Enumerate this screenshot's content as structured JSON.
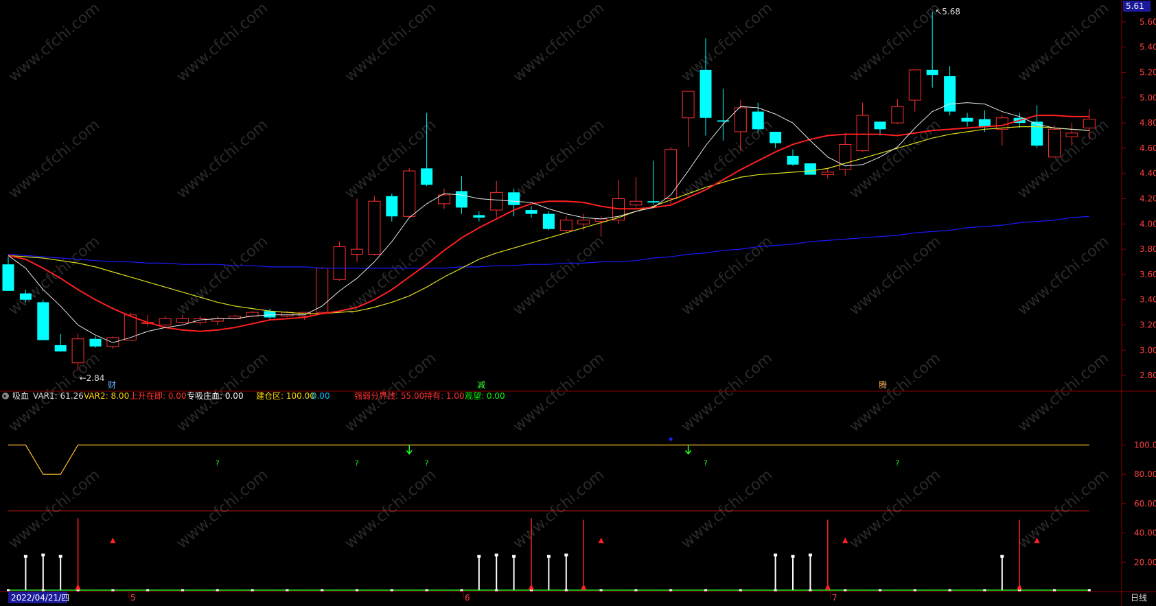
{
  "price_axis": {
    "current": "5.61",
    "ticks": [
      "5.60",
      "5.40",
      "5.20",
      "5.00",
      "4.80",
      "4.60",
      "4.40",
      "4.20",
      "4.00",
      "3.80",
      "3.60",
      "3.40",
      "3.20",
      "3.00",
      "2.80"
    ]
  },
  "indicator_axis": {
    "ticks": [
      "100.00",
      "80.00",
      "60.00",
      "40.00",
      "20.00"
    ]
  },
  "annotations": {
    "high": "5.68",
    "low": "2.84"
  },
  "event_markers": [
    {
      "text": "财"
    },
    {
      "text": "减"
    },
    {
      "text": "腾"
    }
  ],
  "indicator_header": {
    "name": "吸血",
    "items": [
      {
        "text": "VAR1: 61.26",
        "color": "#dddddd"
      },
      {
        "text": "VAR2: 8.00",
        "color": "#ffd700"
      },
      {
        "text": "上升在即: 0.00",
        "color": "#ff3030"
      },
      {
        "text": "专吸庄血: 0.00",
        "color": "#ffffff"
      },
      {
        "text": "建仓区: 100.00",
        "color": "#ffd700"
      },
      {
        "text": ": 0.00",
        "color": "#00bfff"
      },
      {
        "text": "强弱分界线: 55.00",
        "color": "#ff3030"
      },
      {
        "text": "持有: 1.00",
        "color": "#ff3030"
      },
      {
        "text": "观望: 0.00",
        "color": "#00ff00"
      }
    ]
  },
  "date_axis": {
    "date": "2022/04/21/四",
    "months": [
      "5",
      "6",
      "7"
    ],
    "period": "日线"
  },
  "colors": {
    "up": "#ff3030",
    "down": "#00ffff",
    "ma5": "#e8e8e8",
    "ma10": "#ff2020",
    "ma20": "#e0e020",
    "ma60": "#1a1aff",
    "grid": "#8b0000"
  },
  "chart_data": {
    "type": "candlestick",
    "ylim": [
      2.73,
      5.73
    ],
    "candles": [
      {
        "o": 3.68,
        "h": 3.74,
        "l": 3.47,
        "c": 3.47
      },
      {
        "o": 3.45,
        "h": 3.48,
        "l": 3.38,
        "c": 3.4
      },
      {
        "o": 3.38,
        "h": 3.4,
        "l": 3.08,
        "c": 3.08
      },
      {
        "o": 3.04,
        "h": 3.13,
        "l": 2.99,
        "c": 2.99
      },
      {
        "o": 2.9,
        "h": 3.13,
        "l": 2.84,
        "c": 3.09
      },
      {
        "o": 3.09,
        "h": 3.11,
        "l": 3.02,
        "c": 3.03
      },
      {
        "o": 3.03,
        "h": 3.11,
        "l": 3.01,
        "c": 3.1
      },
      {
        "o": 3.08,
        "h": 3.3,
        "l": 3.08,
        "c": 3.28
      },
      {
        "o": 3.22,
        "h": 3.28,
        "l": 3.19,
        "c": 3.22
      },
      {
        "o": 3.2,
        "h": 3.27,
        "l": 3.19,
        "c": 3.25
      },
      {
        "o": 3.22,
        "h": 3.28,
        "l": 3.21,
        "c": 3.25
      },
      {
        "o": 3.22,
        "h": 3.27,
        "l": 3.2,
        "c": 3.25
      },
      {
        "o": 3.23,
        "h": 3.27,
        "l": 3.2,
        "c": 3.25
      },
      {
        "o": 3.25,
        "h": 3.28,
        "l": 3.24,
        "c": 3.27
      },
      {
        "o": 3.27,
        "h": 3.31,
        "l": 3.26,
        "c": 3.3
      },
      {
        "o": 3.31,
        "h": 3.33,
        "l": 3.25,
        "c": 3.26
      },
      {
        "o": 3.27,
        "h": 3.31,
        "l": 3.26,
        "c": 3.3
      },
      {
        "o": 3.27,
        "h": 3.3,
        "l": 3.24,
        "c": 3.3
      },
      {
        "o": 3.3,
        "h": 3.66,
        "l": 3.29,
        "c": 3.65
      },
      {
        "o": 3.56,
        "h": 3.86,
        "l": 3.55,
        "c": 3.82
      },
      {
        "o": 3.76,
        "h": 4.2,
        "l": 3.7,
        "c": 3.8
      },
      {
        "o": 3.76,
        "h": 4.22,
        "l": 3.75,
        "c": 4.18
      },
      {
        "o": 4.22,
        "h": 4.24,
        "l": 4.02,
        "c": 4.06
      },
      {
        "o": 4.06,
        "h": 4.44,
        "l": 4.05,
        "c": 4.42
      },
      {
        "o": 4.44,
        "h": 4.88,
        "l": 4.3,
        "c": 4.31
      },
      {
        "o": 4.16,
        "h": 4.28,
        "l": 4.12,
        "c": 4.23
      },
      {
        "o": 4.26,
        "h": 4.38,
        "l": 4.08,
        "c": 4.13
      },
      {
        "o": 4.07,
        "h": 4.1,
        "l": 4.02,
        "c": 4.05
      },
      {
        "o": 4.11,
        "h": 4.34,
        "l": 4.05,
        "c": 4.25
      },
      {
        "o": 4.25,
        "h": 4.28,
        "l": 4.06,
        "c": 4.15
      },
      {
        "o": 4.11,
        "h": 4.14,
        "l": 4.05,
        "c": 4.08
      },
      {
        "o": 4.08,
        "h": 4.1,
        "l": 3.95,
        "c": 3.96
      },
      {
        "o": 3.95,
        "h": 4.06,
        "l": 3.93,
        "c": 4.03
      },
      {
        "o": 4.0,
        "h": 4.08,
        "l": 3.95,
        "c": 4.03
      },
      {
        "o": 4.02,
        "h": 4.06,
        "l": 3.9,
        "c": 4.04
      },
      {
        "o": 4.03,
        "h": 4.35,
        "l": 4.0,
        "c": 4.2
      },
      {
        "o": 4.15,
        "h": 4.37,
        "l": 4.13,
        "c": 4.18
      },
      {
        "o": 4.18,
        "h": 4.5,
        "l": 4.15,
        "c": 4.17
      },
      {
        "o": 4.2,
        "h": 4.61,
        "l": 4.16,
        "c": 4.59
      },
      {
        "o": 4.84,
        "h": 5.02,
        "l": 4.61,
        "c": 5.05
      },
      {
        "o": 5.22,
        "h": 5.47,
        "l": 4.7,
        "c": 4.84
      },
      {
        "o": 4.82,
        "h": 5.07,
        "l": 4.66,
        "c": 4.81
      },
      {
        "o": 4.73,
        "h": 4.98,
        "l": 4.58,
        "c": 4.92
      },
      {
        "o": 4.89,
        "h": 4.96,
        "l": 4.72,
        "c": 4.75
      },
      {
        "o": 4.73,
        "h": 4.73,
        "l": 4.6,
        "c": 4.64
      },
      {
        "o": 4.54,
        "h": 4.59,
        "l": 4.46,
        "c": 4.47
      },
      {
        "o": 4.48,
        "h": 4.48,
        "l": 4.39,
        "c": 4.39
      },
      {
        "o": 4.39,
        "h": 4.44,
        "l": 4.36,
        "c": 4.41
      },
      {
        "o": 4.43,
        "h": 4.72,
        "l": 4.38,
        "c": 4.63
      },
      {
        "o": 4.58,
        "h": 4.96,
        "l": 4.57,
        "c": 4.86
      },
      {
        "o": 4.81,
        "h": 4.81,
        "l": 4.7,
        "c": 4.75
      },
      {
        "o": 4.8,
        "h": 4.99,
        "l": 4.79,
        "c": 4.93
      },
      {
        "o": 4.98,
        "h": 5.22,
        "l": 4.89,
        "c": 5.22
      },
      {
        "o": 5.22,
        "h": 5.68,
        "l": 5.08,
        "c": 5.18
      },
      {
        "o": 5.17,
        "h": 5.25,
        "l": 4.86,
        "c": 4.89
      },
      {
        "o": 4.84,
        "h": 4.88,
        "l": 4.77,
        "c": 4.81
      },
      {
        "o": 4.83,
        "h": 4.9,
        "l": 4.73,
        "c": 4.77
      },
      {
        "o": 4.75,
        "h": 4.86,
        "l": 4.62,
        "c": 4.84
      },
      {
        "o": 4.84,
        "h": 4.88,
        "l": 4.76,
        "c": 4.8
      },
      {
        "o": 4.81,
        "h": 4.94,
        "l": 4.6,
        "c": 4.62
      },
      {
        "o": 4.53,
        "h": 4.78,
        "l": 4.53,
        "c": 4.75
      },
      {
        "o": 4.69,
        "h": 4.8,
        "l": 4.62,
        "c": 4.72
      },
      {
        "o": 4.76,
        "h": 4.91,
        "l": 4.67,
        "c": 4.83
      }
    ],
    "ma5": [
      3.75,
      3.65,
      3.48,
      3.35,
      3.2,
      3.12,
      3.06,
      3.1,
      3.15,
      3.18,
      3.2,
      3.24,
      3.25,
      3.25,
      3.27,
      3.28,
      3.28,
      3.28,
      3.35,
      3.47,
      3.57,
      3.7,
      3.86,
      4.05,
      4.16,
      4.24,
      4.23,
      4.2,
      4.19,
      4.18,
      4.17,
      4.12,
      4.08,
      4.05,
      4.04,
      4.06,
      4.1,
      4.13,
      4.23,
      4.42,
      4.62,
      4.79,
      4.93,
      4.92,
      4.87,
      4.8,
      4.66,
      4.53,
      4.46,
      4.47,
      4.53,
      4.61,
      4.76,
      4.89,
      4.95,
      4.96,
      4.95,
      4.89,
      4.85,
      4.79,
      4.76,
      4.75,
      4.74
    ],
    "ma10": [
      3.75,
      3.72,
      3.65,
      3.57,
      3.48,
      3.4,
      3.33,
      3.27,
      3.22,
      3.18,
      3.16,
      3.15,
      3.16,
      3.18,
      3.21,
      3.24,
      3.25,
      3.26,
      3.29,
      3.31,
      3.34,
      3.4,
      3.48,
      3.58,
      3.68,
      3.79,
      3.89,
      3.97,
      4.04,
      4.11,
      4.16,
      4.18,
      4.18,
      4.17,
      4.14,
      4.12,
      4.12,
      4.13,
      4.15,
      4.21,
      4.27,
      4.35,
      4.43,
      4.5,
      4.57,
      4.63,
      4.67,
      4.7,
      4.71,
      4.71,
      4.71,
      4.7,
      4.72,
      4.74,
      4.75,
      4.76,
      4.77,
      4.78,
      4.82,
      4.86,
      4.86,
      4.85,
      4.85
    ],
    "ma20": [
      3.75,
      3.74,
      3.73,
      3.71,
      3.69,
      3.66,
      3.62,
      3.58,
      3.54,
      3.5,
      3.46,
      3.42,
      3.38,
      3.35,
      3.33,
      3.31,
      3.3,
      3.29,
      3.29,
      3.3,
      3.31,
      3.34,
      3.38,
      3.43,
      3.5,
      3.58,
      3.65,
      3.72,
      3.77,
      3.81,
      3.85,
      3.89,
      3.93,
      3.97,
      4.01,
      4.05,
      4.1,
      4.14,
      4.19,
      4.24,
      4.29,
      4.33,
      4.37,
      4.39,
      4.4,
      4.41,
      4.42,
      4.44,
      4.48,
      4.52,
      4.56,
      4.6,
      4.64,
      4.68,
      4.71,
      4.73,
      4.75,
      4.76,
      4.77,
      4.77,
      4.76,
      4.75,
      4.74
    ],
    "ma60": [
      3.76,
      3.75,
      3.74,
      3.73,
      3.72,
      3.71,
      3.7,
      3.7,
      3.69,
      3.69,
      3.68,
      3.68,
      3.68,
      3.67,
      3.67,
      3.66,
      3.66,
      3.66,
      3.65,
      3.65,
      3.65,
      3.65,
      3.65,
      3.65,
      3.65,
      3.65,
      3.66,
      3.66,
      3.67,
      3.67,
      3.68,
      3.68,
      3.69,
      3.69,
      3.7,
      3.7,
      3.71,
      3.73,
      3.74,
      3.76,
      3.77,
      3.79,
      3.8,
      3.82,
      3.83,
      3.84,
      3.86,
      3.87,
      3.88,
      3.89,
      3.9,
      3.91,
      3.93,
      3.94,
      3.95,
      3.97,
      3.98,
      3.99,
      4.01,
      4.02,
      4.03,
      4.05,
      4.06
    ],
    "indicator": {
      "ylim": [
        0,
        125
      ],
      "yellow_line": [
        100,
        100,
        80,
        80,
        100,
        100,
        100,
        100,
        100,
        100,
        100,
        100,
        100,
        100,
        100,
        100,
        100,
        100,
        100,
        100,
        100,
        100,
        100,
        100,
        100,
        100,
        100,
        100,
        100,
        100,
        100,
        100,
        100,
        100,
        100,
        100,
        100,
        100,
        100,
        100,
        100,
        100,
        100,
        100,
        100,
        100,
        100,
        100,
        100,
        100,
        100,
        100,
        100,
        100,
        100,
        100,
        100,
        100,
        100,
        100,
        100,
        100,
        100
      ],
      "threshold": 55,
      "white_bars": [
        {
          "i": 1,
          "v": 24
        },
        {
          "i": 2,
          "v": 25
        },
        {
          "i": 3,
          "v": 24
        },
        {
          "i": 27,
          "v": 24
        },
        {
          "i": 28,
          "v": 25
        },
        {
          "i": 29,
          "v": 24
        },
        {
          "i": 31,
          "v": 24
        },
        {
          "i": 32,
          "v": 25
        },
        {
          "i": 44,
          "v": 25
        },
        {
          "i": 45,
          "v": 24
        },
        {
          "i": 46,
          "v": 25
        },
        {
          "i": 57,
          "v": 24
        }
      ],
      "red_bars": [
        {
          "i": 4,
          "v": 50
        },
        {
          "i": 30,
          "v": 50
        },
        {
          "i": 33,
          "v": 49
        },
        {
          "i": 47,
          "v": 49
        },
        {
          "i": 58,
          "v": 49
        }
      ],
      "red_triangles": [
        6,
        34,
        48,
        59
      ],
      "green_down_arrows": [
        23,
        39
      ],
      "question_marks": [
        {
          "i": 12,
          "v": 86
        },
        {
          "i": 20,
          "v": 86
        },
        {
          "i": 24,
          "v": 86
        },
        {
          "i": 40,
          "v": 86
        },
        {
          "i": 51,
          "v": 86
        }
      ],
      "blue_dot": 38
    }
  }
}
